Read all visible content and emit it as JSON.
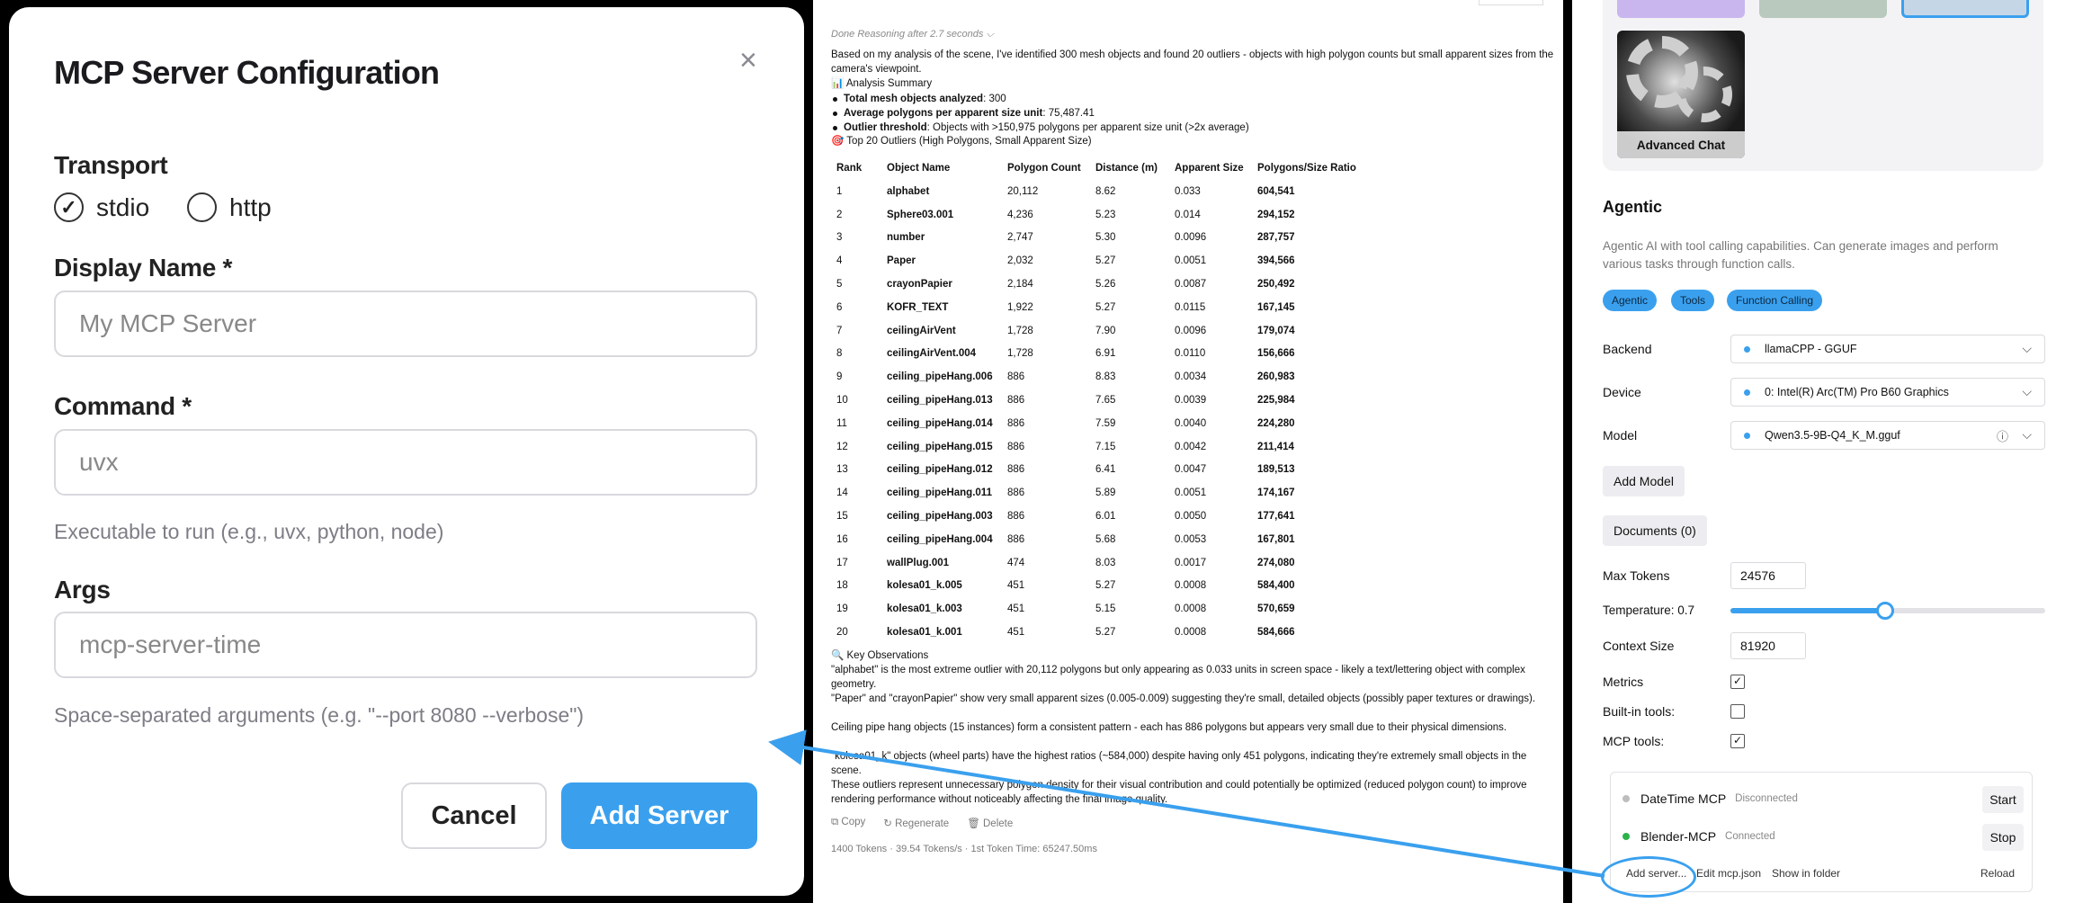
{
  "modal": {
    "title": "MCP Server Configuration",
    "close_icon": "×",
    "transport_label": "Transport",
    "transport_options": [
      "stdio",
      "http"
    ],
    "transport_selected": "stdio",
    "display_name_label": "Display Name *",
    "display_name_placeholder": "My MCP Server",
    "command_label": "Command *",
    "command_placeholder": "uvx",
    "command_hint": "Executable to run (e.g., uvx, python, node)",
    "args_label": "Args",
    "args_placeholder": "mcp-server-time",
    "args_hint": "Space-separated arguments (e.g. \"--port 8080 --verbose\")",
    "cancel_label": "Cancel",
    "add_label": "Add Server"
  },
  "chat": {
    "reasoning": "Done Reasoning after 2.7 seconds ⌵",
    "intro": "Based on my analysis of the scene, I've identified 300 mesh objects and found 20 outliers - objects with high polygon counts but small apparent sizes from the camera's viewpoint.",
    "summary_heading": "📊 Analysis Summary",
    "summary_items": [
      {
        "label": "Total mesh objects analyzed",
        "value": ": 300"
      },
      {
        "label": "Average polygons per apparent size unit",
        "value": ": 75,487.41"
      },
      {
        "label": "Outlier threshold",
        "value": ": Objects with >150,975 polygons per apparent size unit (>2x average)"
      }
    ],
    "table_heading": "🎯 Top 20 Outliers (High Polygons, Small Apparent Size)",
    "table_headers": [
      "Rank",
      "Object Name",
      "Polygon Count",
      "Distance (m)",
      "Apparent Size",
      "Polygons/Size Ratio"
    ],
    "table_rows": [
      [
        "1",
        "alphabet",
        "20,112",
        "8.62",
        "0.033",
        "604,541"
      ],
      [
        "2",
        "Sphere03.001",
        "4,236",
        "5.23",
        "0.014",
        "294,152"
      ],
      [
        "3",
        "number",
        "2,747",
        "5.30",
        "0.0096",
        "287,757"
      ],
      [
        "4",
        "Paper",
        "2,032",
        "5.27",
        "0.0051",
        "394,566"
      ],
      [
        "5",
        "crayonPapier",
        "2,184",
        "5.26",
        "0.0087",
        "250,492"
      ],
      [
        "6",
        "KOFR_TEXT",
        "1,922",
        "5.27",
        "0.0115",
        "167,145"
      ],
      [
        "7",
        "ceilingAirVent",
        "1,728",
        "7.90",
        "0.0096",
        "179,074"
      ],
      [
        "8",
        "ceilingAirVent.004",
        "1,728",
        "6.91",
        "0.0110",
        "156,666"
      ],
      [
        "9",
        "ceiling_pipeHang.006",
        "886",
        "8.83",
        "0.0034",
        "260,983"
      ],
      [
        "10",
        "ceiling_pipeHang.013",
        "886",
        "7.65",
        "0.0039",
        "225,984"
      ],
      [
        "11",
        "ceiling_pipeHang.014",
        "886",
        "7.59",
        "0.0040",
        "224,280"
      ],
      [
        "12",
        "ceiling_pipeHang.015",
        "886",
        "7.15",
        "0.0042",
        "211,414"
      ],
      [
        "13",
        "ceiling_pipeHang.012",
        "886",
        "6.41",
        "0.0047",
        "189,513"
      ],
      [
        "14",
        "ceiling_pipeHang.011",
        "886",
        "5.89",
        "0.0051",
        "174,167"
      ],
      [
        "15",
        "ceiling_pipeHang.003",
        "886",
        "6.01",
        "0.0050",
        "177,641"
      ],
      [
        "16",
        "ceiling_pipeHang.004",
        "886",
        "5.68",
        "0.0053",
        "167,801"
      ],
      [
        "17",
        "wallPlug.001",
        "474",
        "8.03",
        "0.0017",
        "274,080"
      ],
      [
        "18",
        "kolesa01_k.005",
        "451",
        "5.27",
        "0.0008",
        "584,400"
      ],
      [
        "19",
        "kolesa01_k.003",
        "451",
        "5.15",
        "0.0008",
        "570,659"
      ],
      [
        "20",
        "kolesa01_k.001",
        "451",
        "5.27",
        "0.0008",
        "584,666"
      ]
    ],
    "observations_heading": "🔍 Key Observations",
    "observations": [
      "\"alphabet\" is the most extreme outlier with 20,112 polygons but only appearing as 0.033 units in screen space - likely a text/lettering object with complex geometry.",
      "\"Paper\" and \"crayonPapier\" show very small apparent sizes (0.005-0.009) suggesting they're small, detailed objects (possibly paper textures or drawings).",
      "Ceiling pipe hang objects (15 instances) form a consistent pattern - each has 886 polygons but appears very small due to their physical dimensions.",
      "\"kolesa01_k\" objects (wheel parts) have the highest ratios (~584,000) despite having only 451 polygons, indicating they're extremely small objects in the scene.",
      "These outliers represent unnecessary polygon density for their visual contribution and could potentially be optimized (reduced polygon count) to improve rendering performance without noticeably affecting the final image quality."
    ],
    "actions": [
      "⧉ Copy",
      "↻ Regenerate",
      "🗑 Delete"
    ],
    "stats": "1400 Tokens  ·  39.54 Tokens/s  ·  1st Token Time: 65247.50ms"
  },
  "settings": {
    "tile_label": "Advanced Chat",
    "heading": "Agentic",
    "description": "Agentic AI with tool calling capabilities. Can generate images and perform various tasks through function calls.",
    "chips": [
      "Agentic",
      "Tools",
      "Function Calling"
    ],
    "backend_label": "Backend",
    "backend_value": "llamaCPP - GGUF",
    "device_label": "Device",
    "device_value": "0: Intel(R) Arc(TM) Pro B60 Graphics",
    "model_label": "Model",
    "model_value": "Qwen3.5-9B-Q4_K_M.gguf",
    "add_model_label": "Add Model",
    "documents_label": "Documents (0)",
    "max_tokens_label": "Max Tokens",
    "max_tokens_value": "24576",
    "temperature_label": "Temperature: 0.7",
    "temperature_fraction": 0.49,
    "context_label": "Context Size",
    "context_value": "81920",
    "metrics_label": "Metrics",
    "builtin_label": "Built-in tools:",
    "mcp_label": "MCP tools:",
    "servers": [
      {
        "name": "DateTime MCP",
        "status": "Disconnected",
        "action": "Start",
        "color": "#bdbdbd"
      },
      {
        "name": "Blender-MCP",
        "status": "Connected",
        "action": "Stop",
        "color": "#2bb34a"
      }
    ],
    "links": [
      "Add server...",
      "Edit mcp.json",
      "Show in folder",
      "Reload"
    ]
  },
  "colors": {
    "accent": "#3aa0ee"
  }
}
